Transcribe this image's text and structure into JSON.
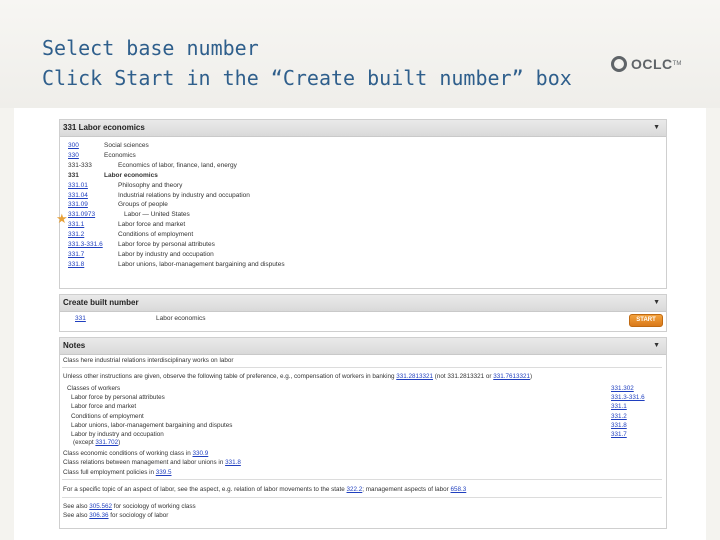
{
  "slide": {
    "title_line1": "Select base number",
    "title_line2": "Click Start in the “Create built number” box",
    "logo_text": "OCLC",
    "logo_tm": "TM"
  },
  "hierarchy": {
    "header": "331 Labor economics",
    "rows": [
      {
        "num": "300",
        "caption": "Social sciences",
        "link": true
      },
      {
        "num": "330",
        "caption": "Economics",
        "link": true
      },
      {
        "num": "331-333",
        "caption": "Economics of labor, finance, land, energy",
        "link": false
      },
      {
        "num": "331",
        "caption": "Labor economics",
        "link": false
      },
      {
        "num": "331.01",
        "caption": "Philosophy and theory",
        "link": true
      },
      {
        "num": "331.04",
        "caption": "Industrial relations by industry and occupation",
        "link": true
      },
      {
        "num": "331.09",
        "caption": "Groups of people",
        "link": true
      },
      {
        "num": "331.0973",
        "caption": "Labor — United States",
        "link": true
      },
      {
        "num": "331.1",
        "caption": "Labor force and market",
        "link": true
      },
      {
        "num": "331.2",
        "caption": "Conditions of employment",
        "link": true
      },
      {
        "num": "331.3-331.6",
        "caption": "Labor force by personal attributes",
        "link": true
      },
      {
        "num": "331.7",
        "caption": "Labor by industry and occupation",
        "link": true
      },
      {
        "num": "331.8",
        "caption": "Labor unions, labor-management bargaining and disputes",
        "link": true
      }
    ]
  },
  "builder": {
    "header": "Create built number",
    "number": "331",
    "caption": "Labor economics",
    "start_label": "START"
  },
  "notes": {
    "header": "Notes",
    "line1": "Class here industrial relations interdisciplinary works on labor",
    "line2_text": "Unless other instructions are given, observe the following table of preference, e.g., compensation of workers in banking",
    "line2_link1": "331.2813321",
    "line2_mid": "(not 331.2813321 or",
    "line2_link2": "331.7613321",
    "line2_end": ")",
    "prefs": [
      {
        "caption": "Classes of workers",
        "num": "331.302"
      },
      {
        "caption": "Labor force by personal attributes",
        "num": "331.3-331.6"
      },
      {
        "caption": "Labor force and market",
        "num": "331.1"
      },
      {
        "caption": "Conditions of employment",
        "num": "331.2"
      },
      {
        "caption": "Labor unions, labor-management bargaining and disputes",
        "num": "331.8"
      },
      {
        "caption": "Labor by industry and occupation",
        "num": "331.7"
      }
    ],
    "except_prefix": "(except",
    "except_link": "331.702",
    "except_suffix": ")",
    "classlines": [
      {
        "text": "Class economic conditions of working class in",
        "link": "330.9"
      },
      {
        "text": "Class relations between management and labor unions in",
        "link": "331.8"
      },
      {
        "text": "Class full employment policies in",
        "link": "339.5"
      }
    ],
    "specific": {
      "text": "For a specific topic of an aspect of labor, see the aspect, e.g. relation of labor movements to the state",
      "link1": "322.2",
      "mid": "; management aspects of labor",
      "link2": "658.3"
    },
    "see_lines": [
      {
        "prefix": "See also",
        "link": "305.562",
        "text": "for sociology of working class"
      },
      {
        "prefix": "See also",
        "link": "306.36",
        "text": "for sociology of labor"
      }
    ]
  }
}
